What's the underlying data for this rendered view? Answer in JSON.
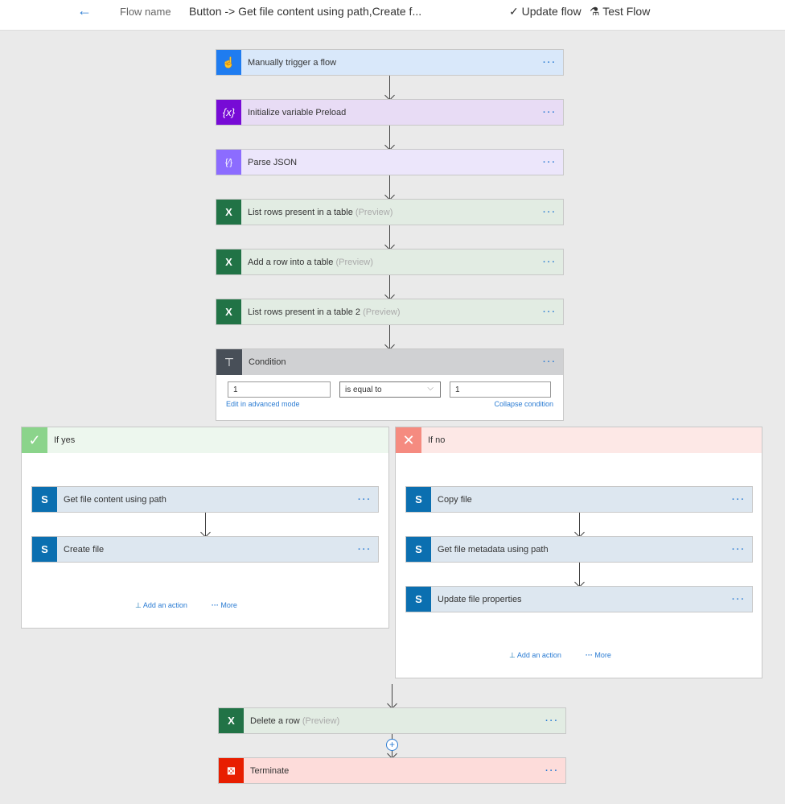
{
  "header": {
    "back_icon": "arrow-left-icon",
    "flow_name_label": "Flow name",
    "flow_title": "Button -> Get file content using path,Create f...",
    "update_flow": "Update flow",
    "test_flow": "Test Flow"
  },
  "steps": [
    {
      "label": "Manually trigger a flow",
      "icon": "touch-icon",
      "color": "#1f7cf0"
    },
    {
      "label": "Initialize variable Preload",
      "icon": "variable-icon",
      "glyph": "{x}",
      "color": "#770bd6"
    },
    {
      "label": "Parse JSON",
      "icon": "json-icon",
      "glyph": "{⁄}",
      "color": "#8c6cff"
    },
    {
      "label": "List rows present in a table",
      "preview": "(Preview)",
      "icon": "excel-icon",
      "glyph": "X"
    },
    {
      "label": "Add a row into a table",
      "preview": "(Preview)",
      "icon": "excel-icon",
      "glyph": "X"
    },
    {
      "label": "List rows present in a table 2",
      "preview": "(Preview)",
      "icon": "excel-icon",
      "glyph": "X"
    }
  ],
  "condition": {
    "label": "Condition",
    "left_value": "1",
    "operator": "is equal to",
    "right_value": "1",
    "edit_advanced": "Edit in advanced mode",
    "collapse": "Collapse condition"
  },
  "if_yes": {
    "label": "If yes",
    "color": "#8bd48b",
    "steps": [
      {
        "label": "Get file content using path",
        "glyph": "S"
      },
      {
        "label": "Create file",
        "glyph": "S"
      }
    ],
    "add_action": "Add an action",
    "more": "More"
  },
  "if_no": {
    "label": "If no",
    "color": "#f58b80",
    "steps": [
      {
        "label": "Copy file",
        "glyph": "S"
      },
      {
        "label": "Get file metadata using path",
        "glyph": "S"
      },
      {
        "label": "Update file properties",
        "glyph": "S"
      }
    ],
    "add_action": "Add an action",
    "more": "More"
  },
  "after": [
    {
      "label": "Delete a row",
      "preview": "(Preview)",
      "glyph": "X"
    },
    {
      "label": "Terminate",
      "glyph": "⊠",
      "color": "#e81e00"
    }
  ],
  "more_dots": "···"
}
